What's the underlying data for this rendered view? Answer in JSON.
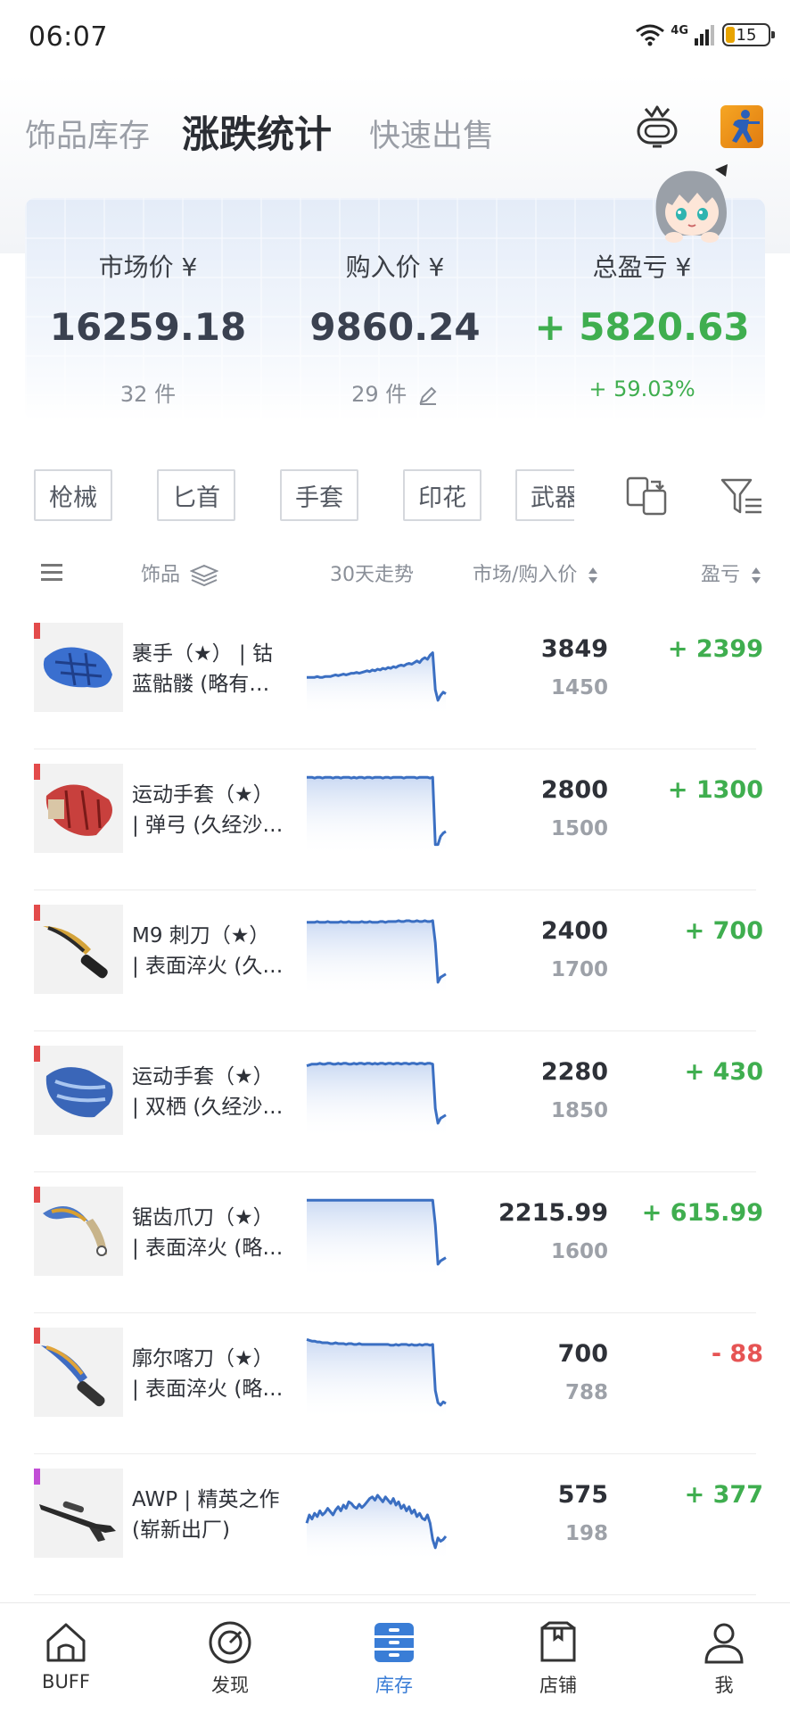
{
  "status_bar": {
    "time": "06:07",
    "network": "4G",
    "battery": "15"
  },
  "header": {
    "tabs": [
      {
        "label": "饰品库存",
        "active": false
      },
      {
        "label": "涨跌统计",
        "active": true
      },
      {
        "label": "快速出售",
        "active": false
      }
    ]
  },
  "summary": {
    "market": {
      "label": "市场价 ¥",
      "value": "16259.18",
      "count": "32 件"
    },
    "purchase": {
      "label": "购入价 ¥",
      "value": "9860.24",
      "count": "29 件"
    },
    "profit": {
      "label": "总盈亏 ¥",
      "value": "+ 5820.63",
      "percent": "+ 59.03%"
    }
  },
  "filters": {
    "chips": [
      "枪械",
      "匕首",
      "手套",
      "印花",
      "武器"
    ]
  },
  "columns": {
    "item": "饰品",
    "trend": "30天走势",
    "price": "市场/购入价",
    "profit": "盈亏"
  },
  "colors": {
    "profit_positive": "#3fae4f",
    "profit_negative": "#e65454",
    "rarity_covert": "#e34b4b",
    "rarity_purple": "#c24ed6",
    "accent": "#3a7dd6",
    "spark_line": "#3b6fc2"
  },
  "items": [
    {
      "name_line1": "裹手（★） | 钴",
      "name_line2": "蓝骷髅 (略有…",
      "market": "3849",
      "buy": "1450",
      "profit": "+ 2399",
      "negative": false,
      "rarity": "red",
      "thumb": "blue-wraps-icon",
      "trend": [
        40,
        40,
        40,
        40,
        41,
        40,
        40,
        41,
        41,
        41,
        42,
        43,
        42,
        43,
        44,
        43,
        44,
        45,
        45,
        46,
        45,
        46,
        47,
        48,
        47,
        49,
        48,
        50,
        49,
        51,
        50,
        52,
        51,
        53,
        52,
        54,
        55,
        54,
        56,
        57,
        56,
        58,
        60,
        58,
        62,
        64,
        62,
        67,
        70,
        25,
        12,
        18,
        22,
        20
      ]
    },
    {
      "name_line1": "运动手套（★）",
      "name_line2": "| 弹弓 (久经沙…",
      "market": "2800",
      "buy": "1500",
      "profit": "+ 1300",
      "negative": false,
      "rarity": "red",
      "thumb": "sport-gloves-red-icon",
      "trend": [
        90,
        90,
        90,
        89,
        90,
        90,
        89,
        90,
        90,
        90,
        89,
        90,
        90,
        89,
        90,
        90,
        90,
        89,
        90,
        89,
        90,
        90,
        89,
        90,
        90,
        89,
        90,
        90,
        90,
        89,
        90,
        90,
        89,
        90,
        90,
        90,
        90,
        89,
        90,
        90,
        90,
        90,
        89,
        90,
        90,
        90,
        90,
        89,
        90,
        8,
        8,
        18,
        22,
        24
      ]
    },
    {
      "name_line1": "M9 刺刀（★）",
      "name_line2": "| 表面淬火 (久…",
      "market": "2400",
      "buy": "1700",
      "profit": "+ 700",
      "negative": false,
      "rarity": "red",
      "thumb": "m9-bayonet-icon",
      "trend": [
        85,
        85,
        85,
        85,
        86,
        85,
        85,
        85,
        86,
        85,
        85,
        85,
        85,
        86,
        85,
        85,
        86,
        85,
        85,
        85,
        85,
        86,
        85,
        85,
        86,
        85,
        85,
        85,
        86,
        86,
        85,
        86,
        86,
        86,
        86,
        87,
        86,
        86,
        87,
        87,
        86,
        86,
        87,
        86,
        86,
        87,
        86,
        86,
        87,
        60,
        12,
        18,
        20,
        22
      ]
    },
    {
      "name_line1": "运动手套（★）",
      "name_line2": "| 双栖 (久经沙…",
      "market": "2280",
      "buy": "1850",
      "profit": "+ 430",
      "negative": false,
      "rarity": "red",
      "thumb": "sport-gloves-blue-icon",
      "trend": [
        82,
        83,
        84,
        84,
        84,
        85,
        84,
        84,
        85,
        85,
        84,
        84,
        85,
        84,
        85,
        85,
        84,
        84,
        85,
        84,
        85,
        85,
        84,
        85,
        85,
        84,
        85,
        84,
        85,
        85,
        84,
        85,
        85,
        84,
        85,
        85,
        84,
        85,
        85,
        84,
        85,
        85,
        84,
        85,
        85,
        84,
        85,
        85,
        84,
        30,
        12,
        18,
        20,
        22
      ]
    },
    {
      "name_line1": "锯齿爪刀（★）",
      "name_line2": "| 表面淬火 (略…",
      "market": "2215.99",
      "buy": "1600",
      "profit": "+ 615.99",
      "negative": false,
      "rarity": "red",
      "thumb": "talon-knife-icon",
      "trend": [
        90,
        90,
        90,
        90,
        90,
        90,
        90,
        90,
        90,
        90,
        90,
        90,
        90,
        90,
        90,
        90,
        90,
        90,
        90,
        90,
        90,
        90,
        90,
        90,
        90,
        90,
        90,
        90,
        90,
        90,
        90,
        90,
        90,
        90,
        90,
        90,
        90,
        90,
        90,
        90,
        90,
        90,
        90,
        90,
        90,
        90,
        90,
        90,
        90,
        60,
        12,
        16,
        18,
        20
      ]
    },
    {
      "name_line1": "廓尔喀刀（★）",
      "name_line2": "| 表面淬火 (略…",
      "market": "700",
      "buy": "788",
      "profit": "- 88",
      "negative": true,
      "rarity": "red",
      "thumb": "kukri-knife-icon",
      "trend": [
        92,
        91,
        90,
        90,
        89,
        89,
        88,
        88,
        88,
        87,
        87,
        88,
        87,
        87,
        87,
        86,
        87,
        87,
        86,
        86,
        87,
        86,
        86,
        86,
        86,
        86,
        86,
        86,
        86,
        86,
        86,
        86,
        85,
        85,
        86,
        85,
        86,
        86,
        86,
        85,
        86,
        85,
        85,
        86,
        85,
        86,
        86,
        85,
        86,
        30,
        15,
        12,
        16,
        14
      ]
    },
    {
      "name_line1": "AWP | 精英之作",
      "name_line2": "(崭新出厂)",
      "market": "575",
      "buy": "198",
      "profit": "+ 377",
      "negative": false,
      "rarity": "purple",
      "thumb": "awp-rifle-icon",
      "trend": [
        40,
        50,
        45,
        52,
        48,
        55,
        50,
        53,
        58,
        54,
        50,
        56,
        60,
        55,
        62,
        58,
        66,
        64,
        60,
        58,
        63,
        59,
        62,
        66,
        70,
        72,
        68,
        74,
        70,
        66,
        72,
        68,
        64,
        70,
        62,
        66,
        58,
        62,
        55,
        60,
        52,
        56,
        48,
        52,
        46,
        44,
        50,
        40,
        20,
        10,
        22,
        18,
        20,
        24
      ]
    }
  ],
  "bottom_nav": [
    {
      "label": "BUFF",
      "icon": "home-icon",
      "active": false
    },
    {
      "label": "发现",
      "icon": "discover-icon",
      "active": false
    },
    {
      "label": "库存",
      "icon": "inventory-icon",
      "active": true
    },
    {
      "label": "店铺",
      "icon": "shop-icon",
      "active": false
    },
    {
      "label": "我",
      "icon": "profile-icon",
      "active": false
    }
  ]
}
